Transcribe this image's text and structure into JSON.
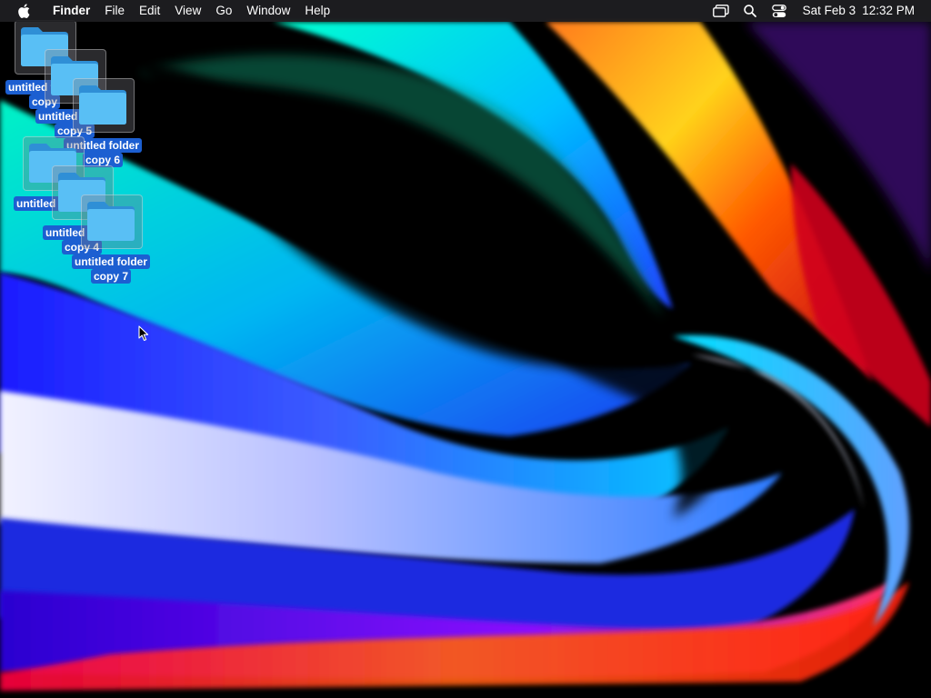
{
  "menubar": {
    "apple_icon": "apple-logo-icon",
    "app_name": "Finder",
    "menus": [
      "File",
      "Edit",
      "View",
      "Go",
      "Window",
      "Help"
    ],
    "status_icons": [
      "screen-mirroring-icon",
      "spotlight-search-icon",
      "control-center-icon"
    ],
    "clock": {
      "date": "Sat Feb 3",
      "time": "12:32 PM"
    }
  },
  "desktop": {
    "icons": [
      {
        "line1": "untitled folder",
        "line2": "copy"
      },
      {
        "line1": "untitled folder",
        "line2": "copy 5"
      },
      {
        "line1": "untitled folder",
        "line2": "copy 6"
      },
      {
        "line1": "untitled folder",
        "line2": ""
      },
      {
        "line1": "untitled folder",
        "line2": "copy 4"
      },
      {
        "line1": "untitled folder",
        "line2": "copy 7"
      }
    ]
  },
  "colors": {
    "menubar_bg": "#1e1e22",
    "selection_label": "#1c5fd1",
    "folder_blue": "#4fb3f0"
  }
}
